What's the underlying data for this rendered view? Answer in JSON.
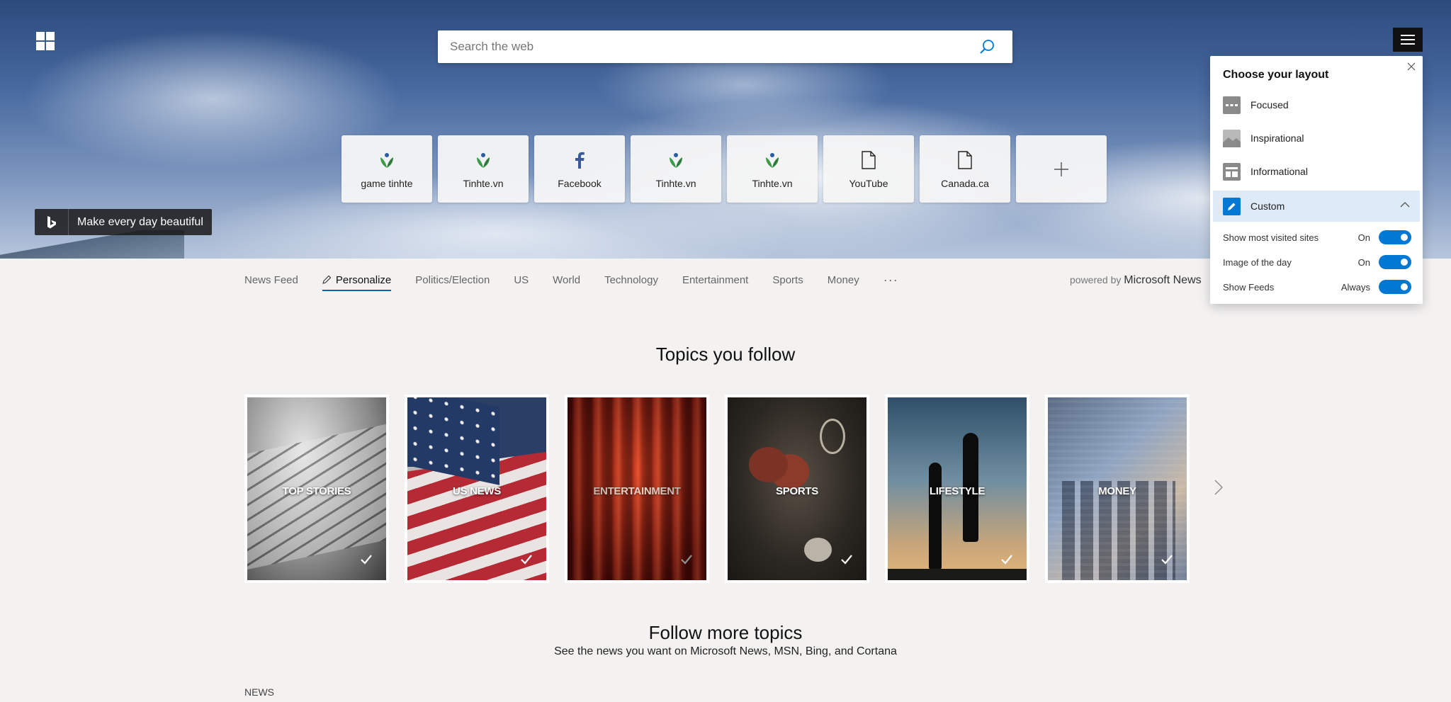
{
  "search": {
    "placeholder": "Search the web"
  },
  "top_sites": [
    {
      "label": "game tinhte",
      "icon": "tinhte-icon"
    },
    {
      "label": "Tinhte.vn",
      "icon": "tinhte-icon"
    },
    {
      "label": "Facebook",
      "icon": "facebook-icon"
    },
    {
      "label": "Tinhte.vn",
      "icon": "tinhte-icon"
    },
    {
      "label": "Tinhte.vn",
      "icon": "tinhte-icon"
    },
    {
      "label": "YouTube",
      "icon": "page-icon"
    },
    {
      "label": "Canada.ca",
      "icon": "page-icon"
    }
  ],
  "bing": {
    "tagline": "Make every day beautiful"
  },
  "nav": {
    "items": [
      "News Feed",
      "Personalize",
      "Politics/Election",
      "US",
      "World",
      "Technology",
      "Entertainment",
      "Sports",
      "Money"
    ],
    "active": "Personalize",
    "more": "···",
    "powered_prefix": "powered by",
    "powered_brand": "Microsoft News"
  },
  "topics": {
    "heading": "Topics you follow",
    "cards": [
      "TOP STORIES",
      "US NEWS",
      "ENTERTAINMENT",
      "SPORTS",
      "LIFESTYLE",
      "MONEY"
    ]
  },
  "follow": {
    "heading": "Follow more topics",
    "subtitle": "See the news you want on Microsoft News, MSN, Bing, and Cortana",
    "section_label": "NEWS"
  },
  "layout_panel": {
    "title": "Choose your layout",
    "options": [
      "Focused",
      "Inspirational",
      "Informational",
      "Custom"
    ],
    "selected": "Custom",
    "toggles": [
      {
        "label": "Show most visited sites",
        "value": "On"
      },
      {
        "label": "Image of the day",
        "value": "On"
      },
      {
        "label": "Show Feeds",
        "value": "Always"
      }
    ]
  },
  "colors": {
    "accent": "#0078d4",
    "tinhte_green": "#3a9b46",
    "tinhte_blue": "#2a5d9f",
    "facebook": "#3b5998"
  }
}
